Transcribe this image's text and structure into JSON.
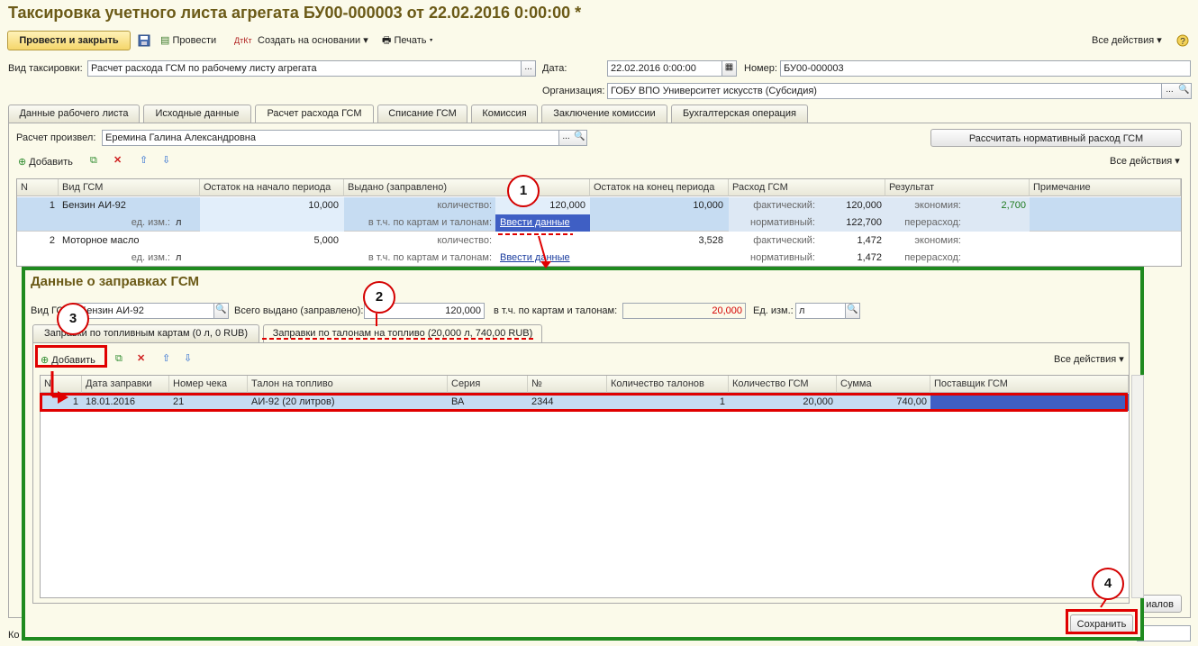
{
  "title": "Таксировка учетного листа агрегата БУ00-000003 от 22.02.2016 0:00:00 *",
  "toolbar": {
    "post_close": "Провести и закрыть",
    "post": "Провести",
    "create_based": "Создать на основании",
    "print": "Печать",
    "all_actions": "Все действия"
  },
  "header": {
    "kind_label": "Вид таксировки:",
    "kind_value": "Расчет расхода ГСМ по рабочему листу агрегата",
    "date_label": "Дата:",
    "date_value": "22.02.2016  0:00:00",
    "number_label": "Номер:",
    "number_value": "БУ00-000003",
    "org_label": "Организация:",
    "org_value": "ГОБУ ВПО Университет искусств (Субсидия)"
  },
  "tabs": [
    "Данные рабочего листа",
    "Исходные данные",
    "Расчет расхода ГСМ",
    "Списание ГСМ",
    "Комиссия",
    "Заключение комиссии",
    "Бухгалтерская операция"
  ],
  "calc": {
    "performer_label": "Расчет произвел:",
    "performer_value": "Еремина Галина Александровна",
    "norm_button": "Рассчитать нормативный расход ГСМ",
    "add": "Добавить",
    "all_actions": "Все действия"
  },
  "main_table": {
    "headers": [
      "N",
      "Вид ГСМ",
      "Остаток на начало периода",
      "Выдано (заправлено)",
      "Остаток на конец периода",
      "Расход ГСМ",
      "Результат",
      "Примечание"
    ],
    "unit_label": "ед. изм.:",
    "qty_label": "количество:",
    "cards_label": "в т.ч. по картам и талонам:",
    "fact_label": "фактический:",
    "norm_label": "нормативный:",
    "economy_label": "экономия:",
    "overuse_label": "перерасход:",
    "rows": [
      {
        "n": "1",
        "name": "Бензин АИ-92",
        "unit": "л",
        "start": "10,000",
        "qty": "120,000",
        "cards": "Ввести данные",
        "end": "10,000",
        "fact": "120,000",
        "norm": "122,700",
        "economy": "2,700"
      },
      {
        "n": "2",
        "name": "Моторное масло",
        "unit": "л",
        "start": "5,000",
        "qty": "",
        "cards": "Ввести данные",
        "end": "3,528",
        "fact": "1,472",
        "norm": "1,472",
        "economy": ""
      }
    ]
  },
  "popup": {
    "title": "Данные о заправках ГСМ",
    "fuel_label": "Вид ГСМ:",
    "fuel_value": "Бензин АИ-92",
    "total_label": "Всего выдано (заправлено):",
    "total_value": "120,000",
    "cards_label": "в т.ч. по картам и талонам:",
    "cards_value": "20,000",
    "unit_label": "Ед. изм.:",
    "unit_value": "л",
    "tab1": "Заправки по топливным картам (0 л, 0 RUB)",
    "tab2": "Заправки по талонам на топливо (20,000 л, 740,00  RUB)",
    "add": "Добавить",
    "all_actions": "Все действия",
    "headers": [
      "N",
      "Дата заправки",
      "Номер чека",
      "Талон на топливо",
      "Серия",
      "№",
      "Количество талонов",
      "Количество ГСМ",
      "Сумма",
      "Поставщик ГСМ"
    ],
    "row": {
      "n": "1",
      "date": "18.01.2016",
      "check": "21",
      "coupon": "АИ-92 (20 литров)",
      "series": "ВА",
      "num": "2344",
      "count": "1",
      "qty": "20,000",
      "sum": "740,00",
      "supplier": ""
    },
    "save": "Сохранить"
  },
  "behind": {
    "materials_tail": "иалов",
    "comment_tail": "Ко"
  },
  "callouts": [
    "1",
    "2",
    "3",
    "4"
  ]
}
